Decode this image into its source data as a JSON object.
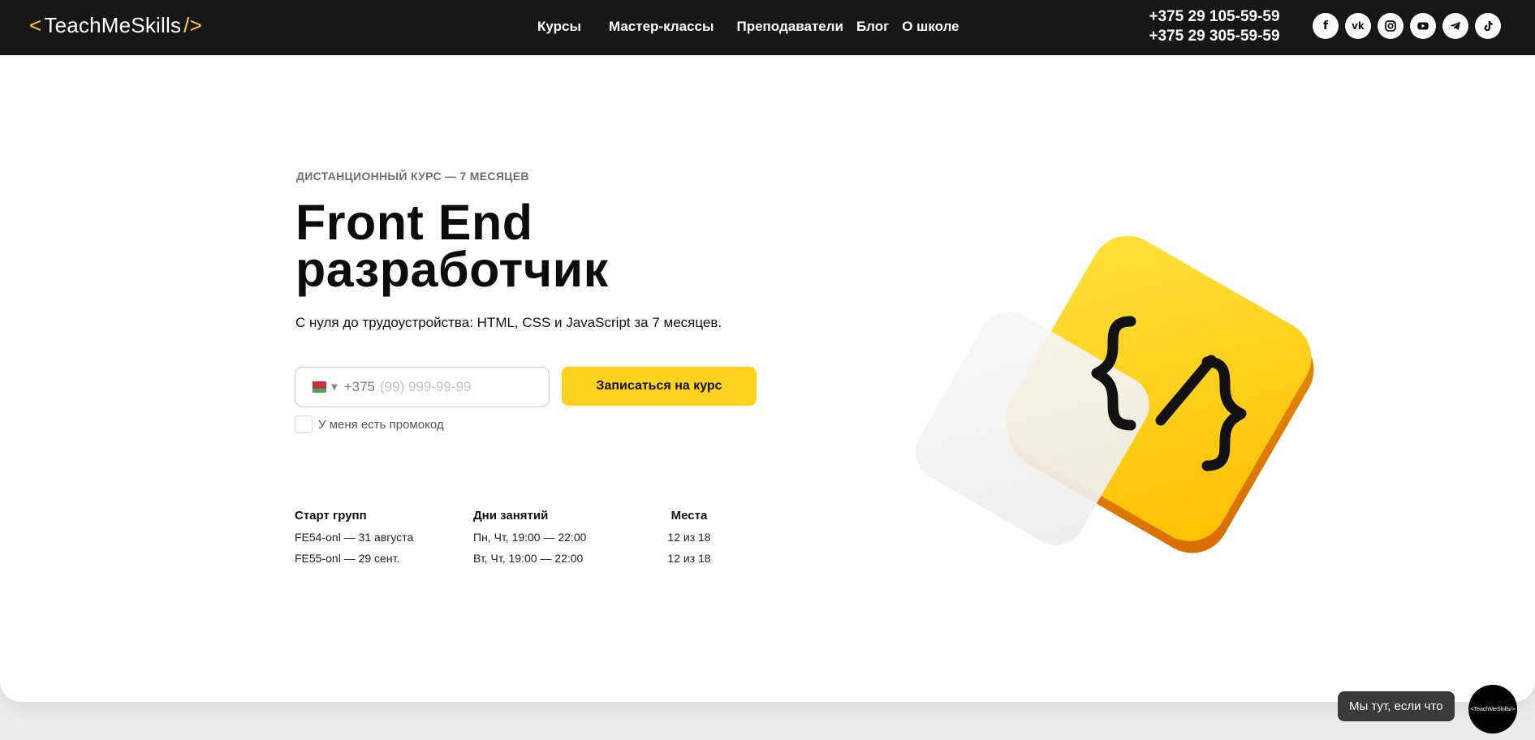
{
  "header": {
    "logo": {
      "left_bracket": "<",
      "name": "TeachMeSkills",
      "right_bracket": "/>"
    },
    "nav": [
      "Курсы",
      "Мастер-классы",
      "Преподаватели",
      "Блог",
      "О школе"
    ],
    "phones": [
      "+375 29 105-59-59",
      "+375 29 305-59-59"
    ],
    "socials": [
      {
        "icon": "facebook-icon",
        "glyph": "f"
      },
      {
        "icon": "vk-icon",
        "glyph": "vk"
      },
      {
        "icon": "instagram-icon",
        "glyph": ""
      },
      {
        "icon": "youtube-icon",
        "glyph": ""
      },
      {
        "icon": "telegram-icon",
        "glyph": ""
      },
      {
        "icon": "tiktok-icon",
        "glyph": ""
      }
    ]
  },
  "hero": {
    "eyebrow": "ДИСТАНЦИОННЫЙ КУРС — 7 МЕСЯЦЕВ",
    "title_line1": "Front End",
    "title_line2": "разработчик",
    "subtitle": "С нуля до трудоустройства: HTML, CSS и JavaScript за 7 месяцев.",
    "form": {
      "country_code": "+375",
      "phone_placeholder": "(99) 999-99-99",
      "submit_label": "Записаться на курс",
      "promo_label": "У меня есть промокод"
    },
    "schedule": {
      "start": {
        "header": "Старт групп",
        "rows": [
          "FE54-onl — 31 августа",
          "FE55-onl — 29 сент."
        ]
      },
      "days": {
        "header": "Дни занятий",
        "rows": [
          "Пн, Чт, 19:00 — 22:00",
          "Вт, Чт, 19:00 — 22:00"
        ]
      },
      "seats": {
        "header": "Места",
        "rows": [
          "12 из 18",
          "12 из 18"
        ]
      }
    },
    "illustration": {
      "glyph": "{/}"
    }
  },
  "chat": {
    "bubble": "Мы тут, если что",
    "button": "<TeachMeSkills/>"
  },
  "colors": {
    "accent": "#ffd21f",
    "header_bg": "#171717"
  }
}
